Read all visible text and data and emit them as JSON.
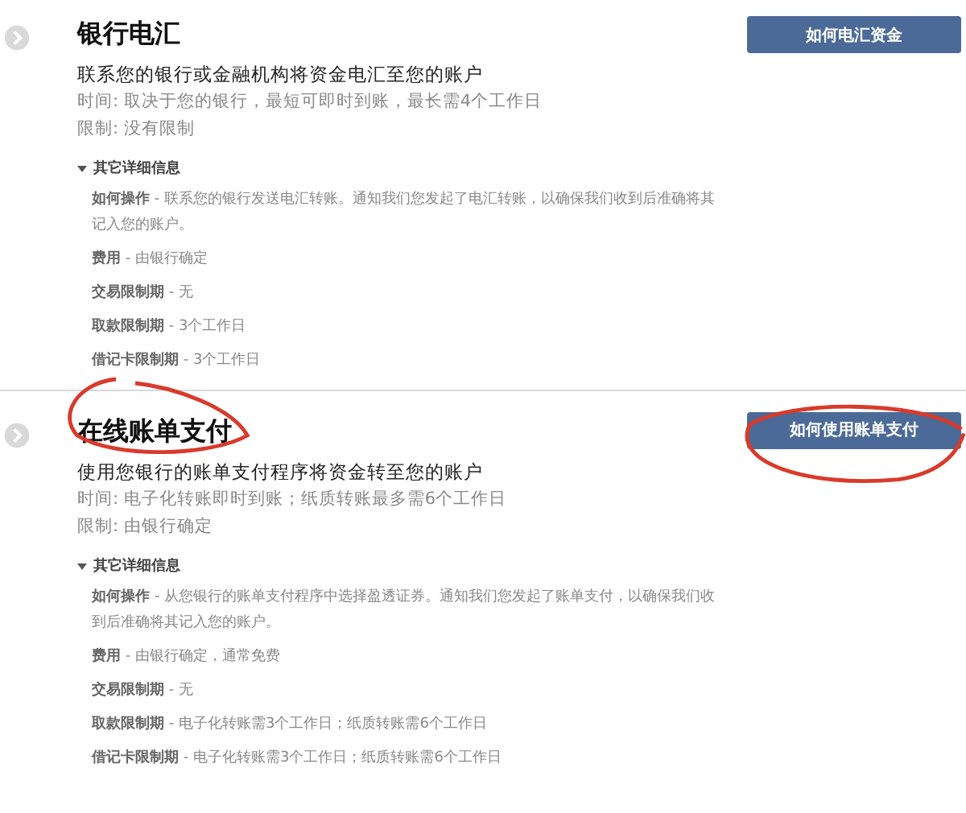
{
  "sections": [
    {
      "title": "银行电汇",
      "title_highlighted": false,
      "subtitle": "联系您的银行或金融机构将资金电汇至您的账户",
      "facts": [
        "时间: 取决于您的银行，最短可即时到账，最长需4个工作日",
        "限制: 没有限制"
      ],
      "button": {
        "label": "如何电汇资金",
        "highlighted": false
      },
      "details": {
        "label": "其它详细信息",
        "expanded": true,
        "items": [
          "**如何操作** - 联系您的银行发送电汇转账。通知我们您发起了电汇转账，以确保我们收到后准确将其记入您的账户。",
          "**费用** - 由银行确定",
          "**交易限制期** - 无",
          "**取款限制期** - 3个工作日",
          "**借记卡限制期** - 3个工作日"
        ]
      }
    },
    {
      "title": "在线账单支付",
      "title_highlighted": true,
      "subtitle": "使用您银行的账单支付程序将资金转至您的账户",
      "facts": [
        "时间: 电子化转账即时到账；纸质转账最多需6个工作日",
        "限制: 由银行确定"
      ],
      "button": {
        "label": "如何使用账单支付",
        "highlighted": true
      },
      "details": {
        "label": "其它详细信息",
        "expanded": true,
        "items": [
          "**如何操作** - 从您银行的账单支付程序中选择盈透证券。通知我们您发起了账单支付，以确保我们收到后准确将其记入您的账户。",
          "**费用** - 由银行确定，通常免费",
          "**交易限制期** - 无",
          "**取款限制期** - 电子化转账需3个工作日；纸质转账需6个工作日",
          "**借记卡限制期** - 电子化转账需3个工作日；纸质转账需6个工作日"
        ]
      }
    }
  ]
}
